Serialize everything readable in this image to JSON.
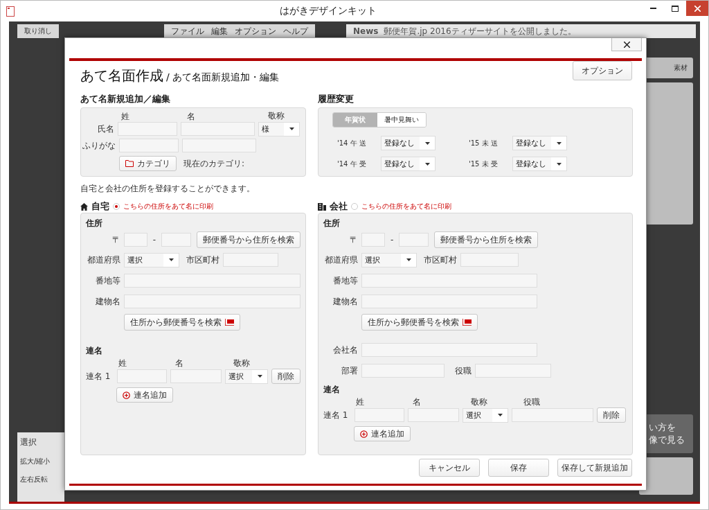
{
  "window": {
    "title": "はがきデザインキット"
  },
  "background": {
    "undo": "取り消し",
    "menu": [
      "ファイル",
      "編集",
      "オプション",
      "ヘルプ"
    ],
    "news_label": "News",
    "news_text": "郵便年賀.jp 2016ティザーサイトを公開しました。",
    "materials": "素材",
    "video_lines": [
      "い方を",
      "像で見る"
    ],
    "tool_tab": "選択",
    "tool_rows": [
      "拡大/縮小",
      "左右反転"
    ]
  },
  "dialog": {
    "title": "あて名面作成",
    "subtitle": "/ あて名面新規追加・編集",
    "option_button": "オプション",
    "name_section": {
      "title": "あて名新規追加／編集",
      "col_last": "姓",
      "col_first": "名",
      "col_honorific": "敬称",
      "name_label": "氏名",
      "furigana_label": "ふりがな",
      "honorific": "様",
      "category_button": "カテゴリ",
      "category_text": "現在のカテゴリ:"
    },
    "history": {
      "title": "履歴変更",
      "tabs": [
        {
          "label": "年賀状",
          "selected": true
        },
        {
          "label": "暑中見舞い",
          "selected": false
        }
      ],
      "rows": [
        {
          "label": "'14 午 送",
          "value": "登録なし"
        },
        {
          "label": "'15 未 送",
          "value": "登録なし"
        },
        {
          "label": "'14 午 受",
          "value": "登録なし"
        },
        {
          "label": "'15 未 受",
          "value": "登録なし"
        }
      ]
    },
    "note": "自宅と会社の住所を登録することができます。",
    "addresses": [
      {
        "kind": "home",
        "title": "自宅",
        "print_label": "こちらの住所をあて名に印刷",
        "selected": true,
        "section": "住所",
        "postal_mark": "〒",
        "postal_dash": "-",
        "postal_search": "郵便番号から住所を検索",
        "pref_label": "都道府県",
        "pref_value": "選択",
        "city_label": "市区町村",
        "street_label": "番地等",
        "building_label": "建物名",
        "address_search": "住所から郵便番号を検索",
        "joint_title": "連名",
        "joint_columns": [
          "姓",
          "名",
          "敬称"
        ],
        "joint_rows": [
          {
            "label": "連名 1",
            "honorific": "選択",
            "delete": "削除"
          }
        ],
        "joint_add": "連名追加"
      },
      {
        "kind": "company",
        "title": "会社",
        "print_label": "こちらの住所をあて名に印刷",
        "selected": false,
        "section": "住所",
        "postal_mark": "〒",
        "postal_dash": "-",
        "postal_search": "郵便番号から住所を検索",
        "pref_label": "都道府県",
        "pref_value": "選択",
        "city_label": "市区町村",
        "street_label": "番地等",
        "building_label": "建物名",
        "address_search": "住所から郵便番号を検索",
        "company_label": "会社名",
        "dept_label": "部署",
        "position_label": "役職",
        "joint_title": "連名",
        "joint_columns": [
          "姓",
          "名",
          "敬称",
          "役職"
        ],
        "joint_rows": [
          {
            "label": "連名 1",
            "honorific": "選択",
            "delete": "削除"
          }
        ],
        "joint_add": "連名追加"
      }
    ],
    "buttons": [
      "キャンセル",
      "保存",
      "保存して新規追加"
    ]
  }
}
